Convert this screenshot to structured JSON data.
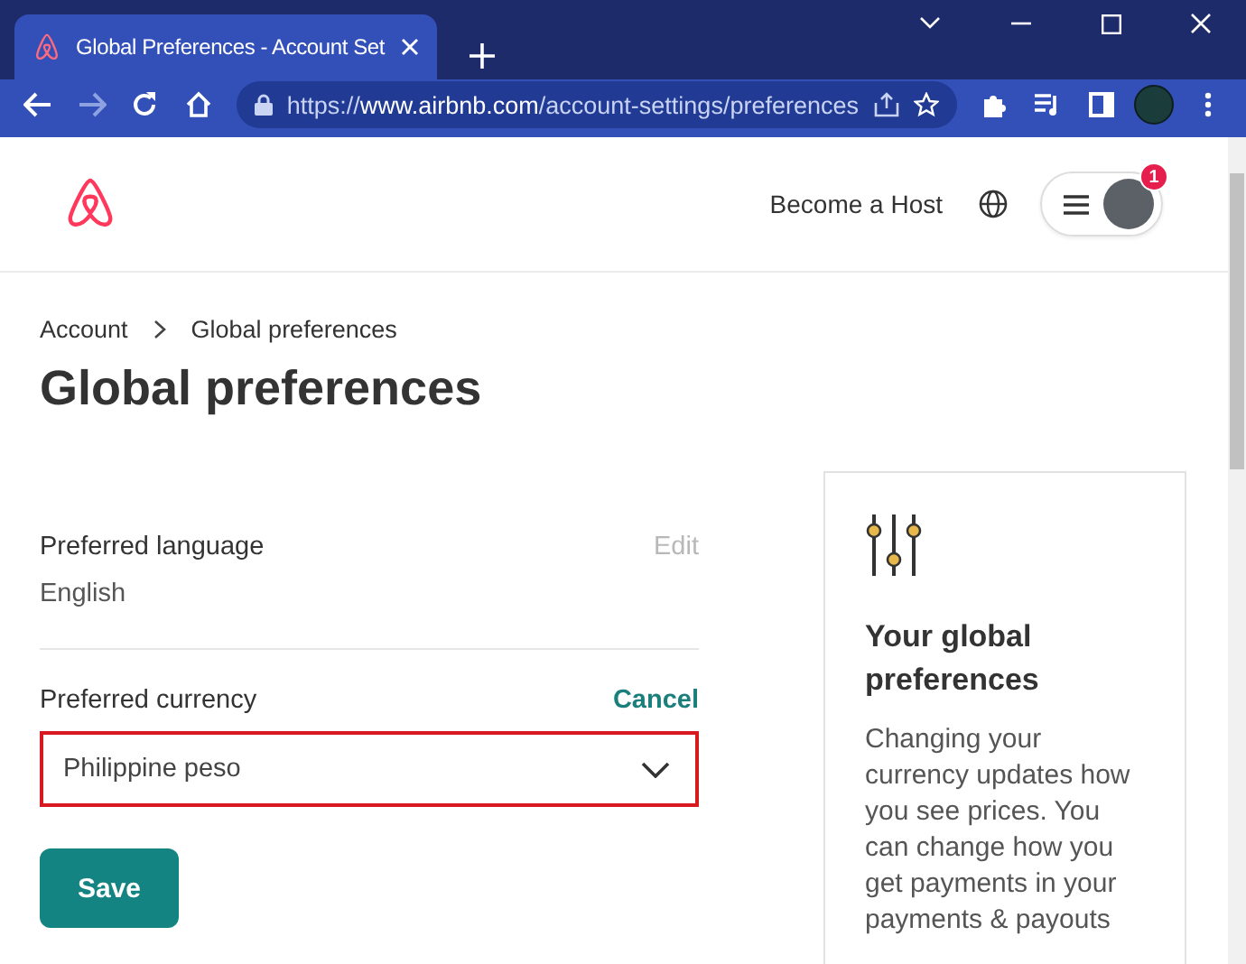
{
  "browser": {
    "tab_title": "Global Preferences - Account Set",
    "url": "https://**www.airbnb.com**/account-settings/preferences"
  },
  "header": {
    "host_link": "Become a Host",
    "notification_count": "1"
  },
  "breadcrumb": [
    {
      "label": "Account"
    },
    {
      "label": "Global preferences"
    }
  ],
  "title": "Global preferences",
  "settings": [
    {
      "kind": "display",
      "label": "Preferred language",
      "value": "English",
      "action": "Edit",
      "disabled": true
    },
    {
      "kind": "select",
      "label": "Preferred currency",
      "value": "Philippine peso",
      "action": "Cancel",
      "disabled": false,
      "highlighted": true
    }
  ],
  "save_button": "Save",
  "info_card": {
    "title": "Your global preferences",
    "body": "Changing your currency updates how you see prices. You can change how you get payments in your payments & payouts"
  }
}
